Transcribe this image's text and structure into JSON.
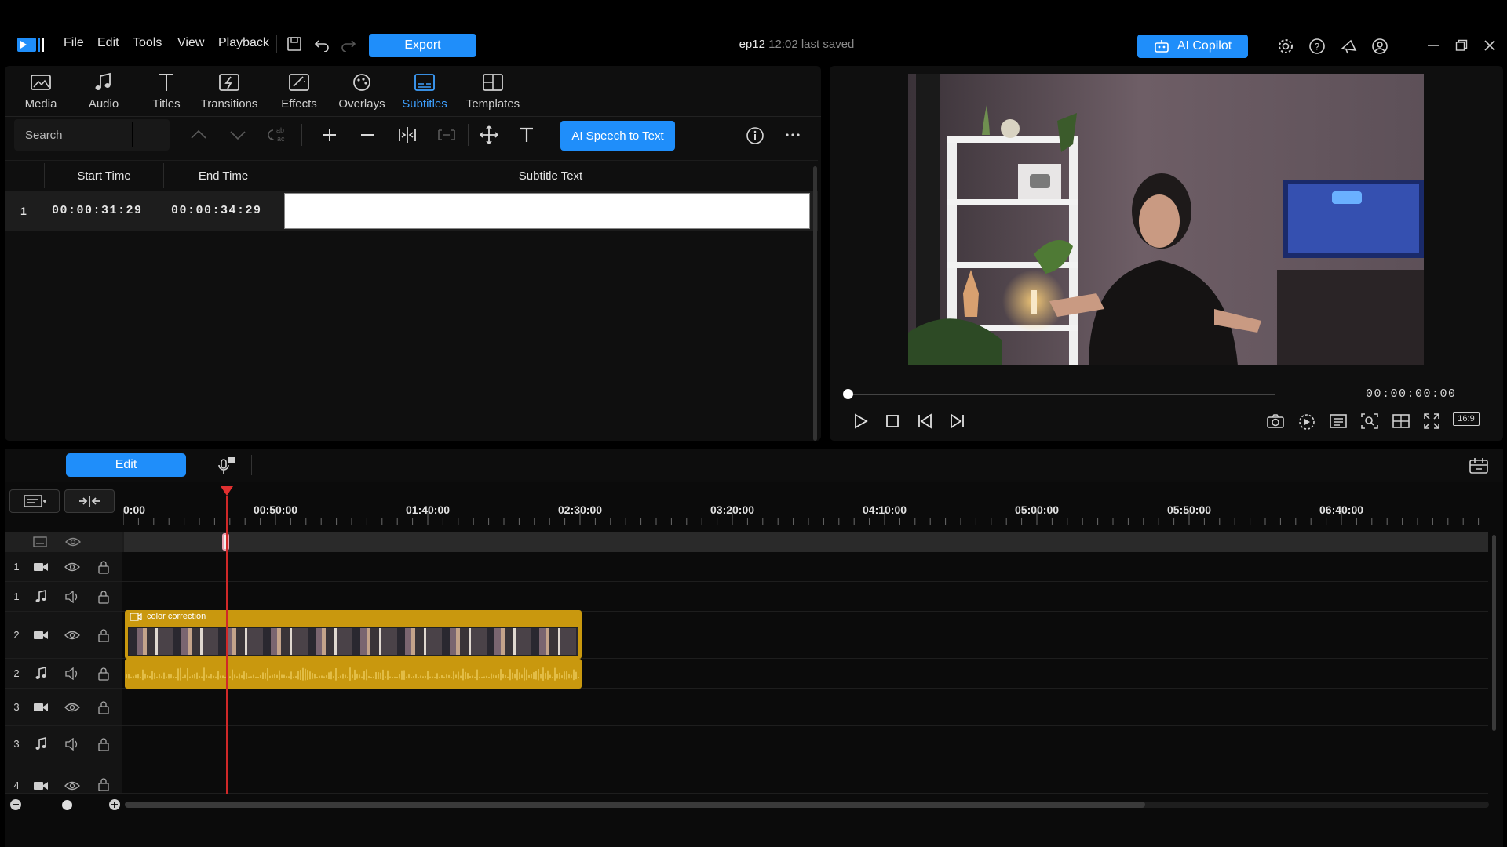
{
  "app": {
    "menu": [
      "File",
      "Edit",
      "Tools",
      "View",
      "Playback"
    ],
    "export_label": "Export",
    "project_name": "ep12",
    "saved_status": "12:02 last saved",
    "copilot_label": "AI Copilot",
    "accent_color": "#1f8efa"
  },
  "rooms": [
    {
      "label": "Media",
      "icon": "media-icon"
    },
    {
      "label": "Audio",
      "icon": "music-note-icon"
    },
    {
      "label": "Titles",
      "icon": "title-t-icon"
    },
    {
      "label": "Transitions",
      "icon": "transitions-icon"
    },
    {
      "label": "Effects",
      "icon": "effects-icon"
    },
    {
      "label": "Overlays",
      "icon": "overlays-icon"
    },
    {
      "label": "Subtitles",
      "icon": "subtitles-icon",
      "active": true
    },
    {
      "label": "Templates",
      "icon": "templates-icon"
    }
  ],
  "subtitles": {
    "search_placeholder": "Search",
    "ai_button": "AI Speech to Text",
    "columns": [
      "Start Time",
      "End Time",
      "Subtitle Text"
    ],
    "rows": [
      {
        "index": "1",
        "start": "00:00:31:29",
        "end": "00:00:34:29",
        "text": ""
      }
    ]
  },
  "preview": {
    "timecode": "00:00:00:00",
    "aspect_ratio": "16:9",
    "progress": 0
  },
  "timeline": {
    "mode_label": "Edit",
    "ruler": [
      "0:00",
      "00:50:00",
      "01:40:00",
      "02:30:00",
      "03:20:00",
      "04:10:00",
      "05:00:00",
      "05:50:00",
      "06:40:00"
    ],
    "tracks": [
      {
        "num": "1",
        "type": "video"
      },
      {
        "num": "1",
        "type": "audio"
      },
      {
        "num": "2",
        "type": "video"
      },
      {
        "num": "2",
        "type": "audio"
      },
      {
        "num": "3",
        "type": "video"
      },
      {
        "num": "3",
        "type": "audio"
      },
      {
        "num": "4",
        "type": "video"
      }
    ],
    "clip_label": "color correction",
    "clip_color": "#c9980e"
  }
}
